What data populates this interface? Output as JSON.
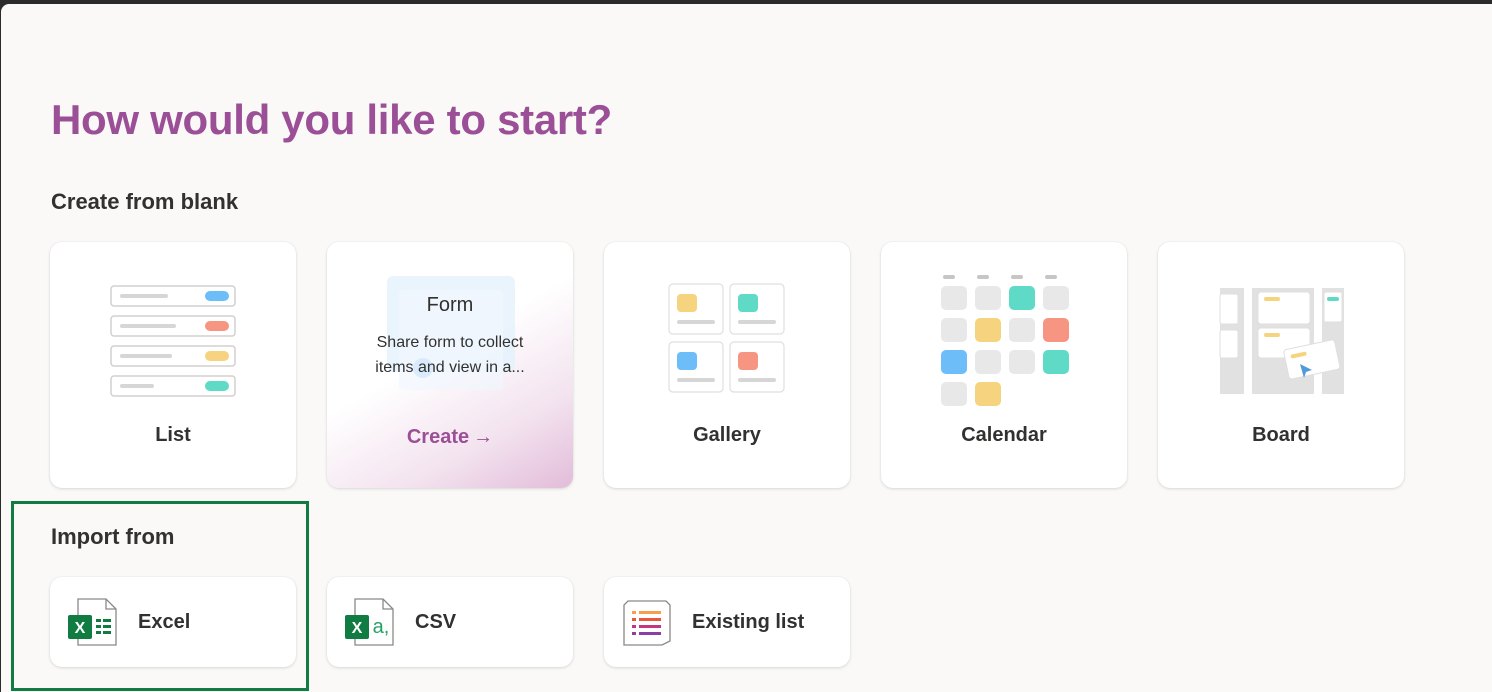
{
  "title": "How would you like to start?",
  "sections": {
    "blank": "Create from blank",
    "import": "Import from"
  },
  "cards": {
    "list": "List",
    "form": {
      "title": "Form",
      "description": "Share form to collect items and view in a...",
      "action": "Create",
      "arrow": "→"
    },
    "gallery": "Gallery",
    "calendar": "Calendar",
    "board": "Board"
  },
  "imports": {
    "excel": "Excel",
    "csv": "CSV",
    "existing": "Existing list"
  },
  "colors": {
    "title": "#9b4f96",
    "highlight": "#107c41",
    "blue": "#6cbdf8",
    "red": "#f59582",
    "yellow": "#f6d37e",
    "teal": "#5fdac7"
  }
}
